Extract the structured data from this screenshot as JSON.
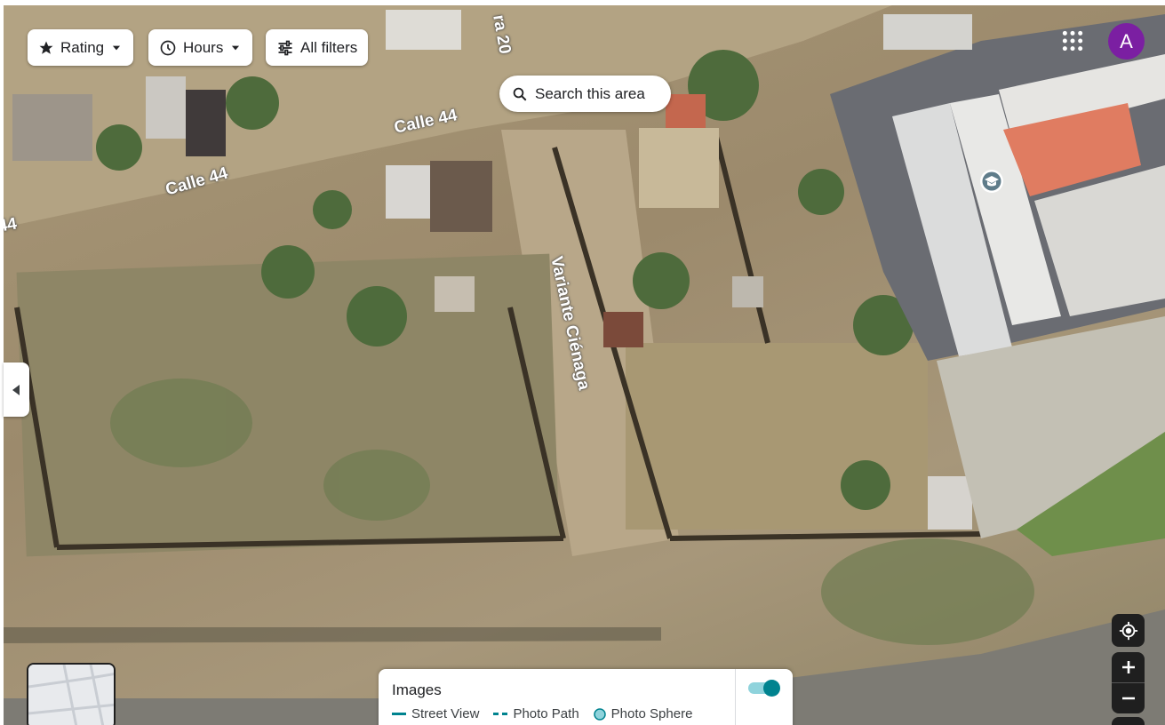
{
  "map": {
    "streets": [
      "Calle 44",
      "Calle 44",
      "Variante Ciénaga",
      "ra 20",
      "44"
    ]
  },
  "filters": {
    "rating_label": "Rating",
    "hours_label": "Hours",
    "all_filters_label": "All filters"
  },
  "search_area_label": "Search this area",
  "account": {
    "avatar_letter": "A",
    "avatar_color": "#7b1fa2"
  },
  "images_panel": {
    "title": "Images",
    "legend": [
      "Street View",
      "Photo Path",
      "Photo Sphere"
    ],
    "toggle_on": true,
    "accent_color": "#00838f"
  },
  "icons": [
    "star-icon",
    "clock-icon",
    "filter-sliders-icon",
    "search-icon",
    "apps-grid-icon",
    "chevron-left-icon",
    "school-icon",
    "my-location-icon",
    "zoom-in-icon",
    "zoom-out-icon"
  ]
}
